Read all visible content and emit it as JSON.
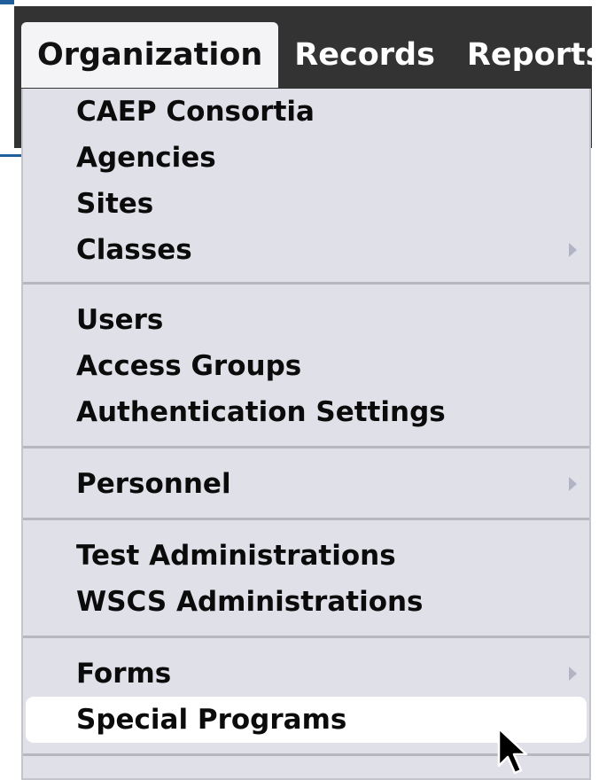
{
  "nav": {
    "tabs": [
      {
        "label": "Organization",
        "active": true
      },
      {
        "label": "Records",
        "active": false
      },
      {
        "label": "Reports",
        "active": false
      }
    ]
  },
  "menu": {
    "groups": [
      {
        "items": [
          {
            "label": "CAEP Consortia",
            "submenu": false
          },
          {
            "label": "Agencies",
            "submenu": false
          },
          {
            "label": "Sites",
            "submenu": false
          },
          {
            "label": "Classes",
            "submenu": true
          }
        ]
      },
      {
        "items": [
          {
            "label": "Users",
            "submenu": false
          },
          {
            "label": "Access Groups",
            "submenu": false
          },
          {
            "label": "Authentication Settings",
            "submenu": false
          }
        ]
      },
      {
        "items": [
          {
            "label": "Personnel",
            "submenu": true
          }
        ]
      },
      {
        "items": [
          {
            "label": "Test Administrations",
            "submenu": false
          },
          {
            "label": "WSCS Administrations",
            "submenu": false
          }
        ]
      },
      {
        "items": [
          {
            "label": "Forms",
            "submenu": true
          },
          {
            "label": "Special Programs",
            "submenu": false,
            "highlighted": true
          }
        ]
      }
    ]
  },
  "colors": {
    "nav_background": "#333333",
    "menu_background": "#e0e0e8",
    "highlight": "#ffffff",
    "accent_blue": "#1f5f9c"
  }
}
